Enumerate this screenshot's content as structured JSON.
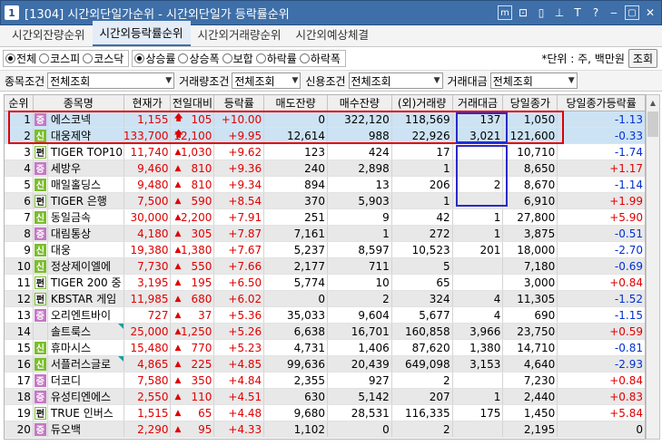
{
  "window": {
    "number": "1",
    "title": "[1304] 시간외단일가순위 - 시간외단일가 등락률순위",
    "icons": [
      "minimize-box-icon",
      "link-icon",
      "split-icon",
      "pin-icon",
      "text-icon",
      "help-icon",
      "dash-icon",
      "restore-icon",
      "close-icon"
    ]
  },
  "tabs": [
    {
      "label": "시간외잔량순위",
      "active": false
    },
    {
      "label": "시간외등락률순위",
      "active": true
    },
    {
      "label": "시간외거래량순위",
      "active": false
    },
    {
      "label": "시간외예상체결",
      "active": false
    }
  ],
  "market_filter": [
    {
      "label": "전체",
      "checked": true
    },
    {
      "label": "코스피",
      "checked": false
    },
    {
      "label": "코스닥",
      "checked": false
    }
  ],
  "sort_filter": [
    {
      "label": "상승률",
      "checked": true
    },
    {
      "label": "상승폭",
      "checked": false
    },
    {
      "label": "보합",
      "checked": false
    },
    {
      "label": "하락률",
      "checked": false
    },
    {
      "label": "하락폭",
      "checked": false
    }
  ],
  "unit_text": "*단위 : 주, 백만원",
  "search_button": "조회",
  "conditions": {
    "stock_label": "종목조건",
    "stock_value": "전체조회",
    "volume_label": "거래량조건",
    "volume_value": "전체조회",
    "credit_label": "신용조건",
    "credit_value": "전체조회",
    "amount_label": "거래대금",
    "amount_value": "전체조회"
  },
  "columns": [
    "순위",
    "종목명",
    "현재가",
    "전일대비",
    "등락률",
    "매도잔량",
    "매수잔량",
    "(외)거래량",
    "거래대금",
    "당일종가",
    "당일종가등락률"
  ],
  "colors": {
    "up": "#e00000",
    "down": "#0030d0",
    "highlight_red": "#e00000",
    "highlight_blue": "#2a2ac8"
  },
  "rows": [
    {
      "rank": "1",
      "badge": "증",
      "name": "에스코넥",
      "price": "1,155",
      "chg_type": "arrow",
      "chg": "105",
      "rate": "+10.00",
      "sell": "0",
      "buy": "322,120",
      "fvol": "118,569",
      "amt": "137",
      "close": "1,050",
      "crate": "-1.13",
      "crate_dir": "dn",
      "tick": false
    },
    {
      "rank": "2",
      "badge": "신",
      "name": "대웅제약",
      "price": "133,700",
      "chg_type": "arrow",
      "chg": "12,100",
      "rate": "+9.95",
      "sell": "12,614",
      "buy": "988",
      "fvol": "22,926",
      "amt": "3,021",
      "close": "121,600",
      "crate": "-0.33",
      "crate_dir": "dn",
      "tick": false
    },
    {
      "rank": "3",
      "badge": "펀",
      "name": "TIGER TOP10",
      "price": "11,740",
      "chg_type": "tri",
      "chg": "1,030",
      "rate": "+9.62",
      "sell": "123",
      "buy": "424",
      "fvol": "17",
      "amt": "",
      "close": "10,710",
      "crate": "-1.74",
      "crate_dir": "dn",
      "tick": false
    },
    {
      "rank": "4",
      "badge": "증",
      "name": "세방우",
      "price": "9,460",
      "chg_type": "tri",
      "chg": "810",
      "rate": "+9.36",
      "sell": "240",
      "buy": "2,898",
      "fvol": "1",
      "amt": "",
      "close": "8,650",
      "crate": "+1.17",
      "crate_dir": "up",
      "tick": false
    },
    {
      "rank": "5",
      "badge": "신",
      "name": "매일홀딩스",
      "price": "9,480",
      "chg_type": "tri",
      "chg": "810",
      "rate": "+9.34",
      "sell": "894",
      "buy": "13",
      "fvol": "206",
      "amt": "2",
      "close": "8,670",
      "crate": "-1.14",
      "crate_dir": "dn",
      "tick": false
    },
    {
      "rank": "6",
      "badge": "펀",
      "name": "TIGER 은행",
      "price": "7,500",
      "chg_type": "tri",
      "chg": "590",
      "rate": "+8.54",
      "sell": "370",
      "buy": "5,903",
      "fvol": "1",
      "amt": "",
      "close": "6,910",
      "crate": "+1.99",
      "crate_dir": "up",
      "tick": false
    },
    {
      "rank": "7",
      "badge": "신",
      "name": "동일금속",
      "price": "30,000",
      "chg_type": "tri",
      "chg": "2,200",
      "rate": "+7.91",
      "sell": "251",
      "buy": "9",
      "fvol": "42",
      "amt": "1",
      "close": "27,800",
      "crate": "+5.90",
      "crate_dir": "up",
      "tick": false
    },
    {
      "rank": "8",
      "badge": "증",
      "name": "대림통상",
      "price": "4,180",
      "chg_type": "tri",
      "chg": "305",
      "rate": "+7.87",
      "sell": "7,161",
      "buy": "1",
      "fvol": "272",
      "amt": "1",
      "close": "3,875",
      "crate": "-0.51",
      "crate_dir": "dn",
      "tick": false
    },
    {
      "rank": "9",
      "badge": "신",
      "name": "대웅",
      "price": "19,380",
      "chg_type": "tri",
      "chg": "1,380",
      "rate": "+7.67",
      "sell": "5,237",
      "buy": "8,597",
      "fvol": "10,523",
      "amt": "201",
      "close": "18,000",
      "crate": "-2.70",
      "crate_dir": "dn",
      "tick": false
    },
    {
      "rank": "10",
      "badge": "신",
      "name": "정상제이엘에",
      "price": "7,730",
      "chg_type": "tri",
      "chg": "550",
      "rate": "+7.66",
      "sell": "2,177",
      "buy": "711",
      "fvol": "5",
      "amt": "",
      "close": "7,180",
      "crate": "-0.69",
      "crate_dir": "dn",
      "tick": false
    },
    {
      "rank": "11",
      "badge": "펀",
      "name": "TIGER 200 중",
      "price": "3,195",
      "chg_type": "tri",
      "chg": "195",
      "rate": "+6.50",
      "sell": "5,774",
      "buy": "10",
      "fvol": "65",
      "amt": "",
      "close": "3,000",
      "crate": "+0.84",
      "crate_dir": "up",
      "tick": false
    },
    {
      "rank": "12",
      "badge": "펀",
      "name": "KBSTAR 게임",
      "price": "11,985",
      "chg_type": "tri",
      "chg": "680",
      "rate": "+6.02",
      "sell": "0",
      "buy": "2",
      "fvol": "324",
      "amt": "4",
      "close": "11,305",
      "crate": "-1.52",
      "crate_dir": "dn",
      "tick": false
    },
    {
      "rank": "13",
      "badge": "증",
      "name": "오리엔트바이",
      "price": "727",
      "chg_type": "tri",
      "chg": "37",
      "rate": "+5.36",
      "sell": "35,033",
      "buy": "9,604",
      "fvol": "5,677",
      "amt": "4",
      "close": "690",
      "crate": "-1.15",
      "crate_dir": "dn",
      "tick": false
    },
    {
      "rank": "14",
      "badge": "",
      "name": "솔트룩스",
      "price": "25,000",
      "chg_type": "tri",
      "chg": "1,250",
      "rate": "+5.26",
      "sell": "6,638",
      "buy": "16,701",
      "fvol": "160,858",
      "amt": "3,966",
      "close": "23,750",
      "crate": "+0.59",
      "crate_dir": "up",
      "tick": true
    },
    {
      "rank": "15",
      "badge": "신",
      "name": "휴마시스",
      "price": "15,480",
      "chg_type": "tri",
      "chg": "770",
      "rate": "+5.23",
      "sell": "4,731",
      "buy": "1,406",
      "fvol": "87,620",
      "amt": "1,380",
      "close": "14,710",
      "crate": "-0.81",
      "crate_dir": "dn",
      "tick": false
    },
    {
      "rank": "16",
      "badge": "신",
      "name": "서플러스글로",
      "price": "4,865",
      "chg_type": "tri",
      "chg": "225",
      "rate": "+4.85",
      "sell": "99,636",
      "buy": "20,439",
      "fvol": "649,098",
      "amt": "3,153",
      "close": "4,640",
      "crate": "-2.93",
      "crate_dir": "dn",
      "tick": true
    },
    {
      "rank": "17",
      "badge": "증",
      "name": "더코디",
      "price": "7,580",
      "chg_type": "tri",
      "chg": "350",
      "rate": "+4.84",
      "sell": "2,355",
      "buy": "927",
      "fvol": "2",
      "amt": "",
      "close": "7,230",
      "crate": "+0.84",
      "crate_dir": "up",
      "tick": false
    },
    {
      "rank": "18",
      "badge": "증",
      "name": "유성티엔에스",
      "price": "2,550",
      "chg_type": "tri",
      "chg": "110",
      "rate": "+4.51",
      "sell": "630",
      "buy": "5,142",
      "fvol": "207",
      "amt": "1",
      "close": "2,440",
      "crate": "+0.83",
      "crate_dir": "up",
      "tick": false
    },
    {
      "rank": "19",
      "badge": "펀",
      "name": "TRUE 인버스",
      "price": "1,515",
      "chg_type": "tri",
      "chg": "65",
      "rate": "+4.48",
      "sell": "9,680",
      "buy": "28,531",
      "fvol": "116,335",
      "amt": "175",
      "close": "1,450",
      "crate": "+5.84",
      "crate_dir": "up",
      "tick": false
    },
    {
      "rank": "20",
      "badge": "증",
      "name": "듀오백",
      "price": "2,290",
      "chg_type": "tri",
      "chg": "95",
      "rate": "+4.33",
      "sell": "1,102",
      "buy": "0",
      "fvol": "2",
      "amt": "",
      "close": "2,195",
      "crate": "0",
      "crate_dir": "flat",
      "tick": false
    }
  ]
}
